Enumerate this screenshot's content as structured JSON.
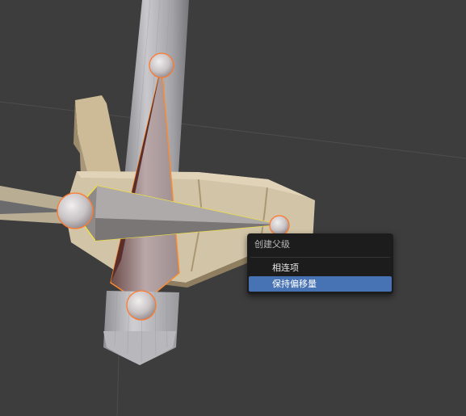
{
  "viewport": {
    "background_color": "#3d3d3d",
    "objects": [
      "bone-joint-icon",
      "armature-bone",
      "mesh-cylinder",
      "mesh-box-segments"
    ]
  },
  "context_menu": {
    "title": "创建父级",
    "items": [
      {
        "label": "相连项",
        "active": false
      },
      {
        "label": "保持偏移量",
        "active": true
      }
    ],
    "highlight_color": "#4772b3",
    "background_color": "#1c1c1c"
  },
  "colors": {
    "bone_selected_outline": "#ff8a2b",
    "bone_active_outline": "#f0e040",
    "mesh_beige": "#cfc0a0",
    "mesh_grey": "#a9a9ad"
  }
}
